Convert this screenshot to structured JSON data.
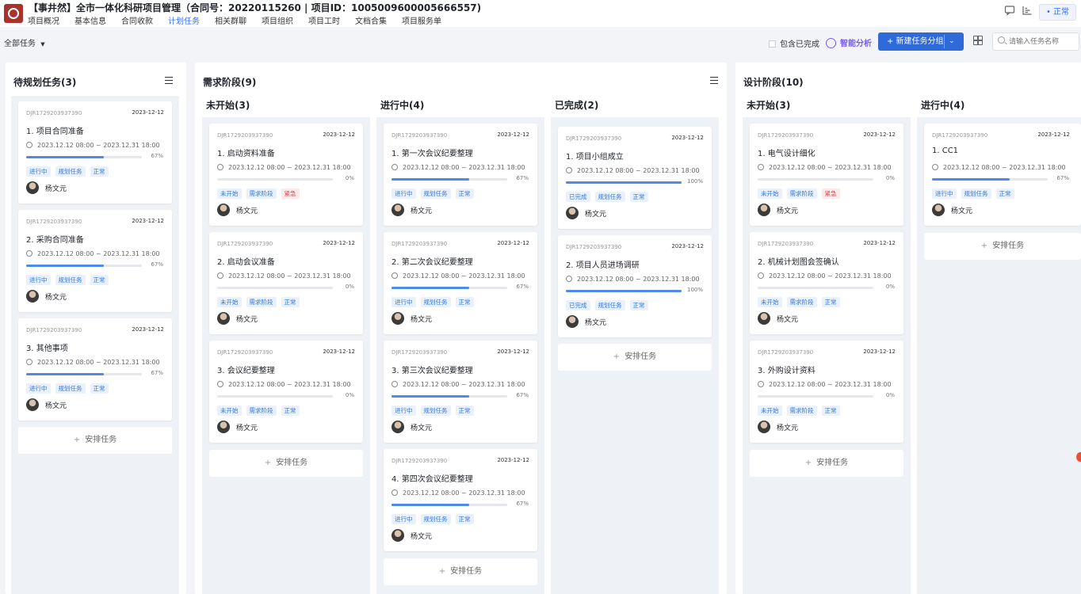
{
  "header": {
    "title": "【事井然】全市一体化科研项目管理（合同号：20220115260 | 项目ID：1005009600005666557)",
    "tabs": [
      "项目概况",
      "基本信息",
      "合同收款",
      "计划任务",
      "相关群聊",
      "项目组织",
      "项目工时",
      "文档合集",
      "项目服务单"
    ],
    "active_tab": "计划任务",
    "status": "• 正常",
    "icons": [
      "chat-icon",
      "chart-icon"
    ]
  },
  "toolbar": {
    "filter_label": "全部任务",
    "include_done_label": "包含已完成",
    "ai_label": "智能分析",
    "new_group_label": "+ 新建任务分组",
    "search_placeholder": "请输入任务名称"
  },
  "common": {
    "add_task": "安排任务",
    "assignee": "杨文元",
    "task_id": "DJR1729203937390",
    "date": "2023-12-12",
    "time_range": "2023.12.12 08:00 ~ 2023.12.31 18:00"
  },
  "boards": {
    "b0": {
      "title": "待规划任务(3)"
    },
    "b1": {
      "title": "需求阶段(9)"
    },
    "b2": {
      "title": "设计阶段(10)"
    }
  },
  "columns": {
    "c0": {
      "cards": [
        {
          "name": "1. 项目合同准备",
          "progress": 67,
          "pct": "67%",
          "tags": [
            "进行中",
            "规划任务",
            "正常"
          ]
        },
        {
          "name": "2. 采购合同准备",
          "progress": 67,
          "pct": "67%",
          "tags": [
            "进行中",
            "规划任务",
            "正常"
          ]
        },
        {
          "name": "3. 其他事项",
          "progress": 67,
          "pct": "67%",
          "tags": [
            "进行中",
            "规划任务",
            "正常"
          ]
        }
      ]
    },
    "c1": {
      "title": "未开始(3)",
      "cards": [
        {
          "name": "1. 启动资料准备",
          "progress": 0,
          "pct": "0%",
          "tags": [
            "未开始",
            "需求阶段",
            "紧急"
          ]
        },
        {
          "name": "2. 启动会议准备",
          "progress": 0,
          "pct": "0%",
          "tags": [
            "未开始",
            "需求阶段",
            "正常"
          ]
        },
        {
          "name": "3. 会议纪要整理",
          "progress": 0,
          "pct": "0%",
          "tags": [
            "未开始",
            "需求阶段",
            "正常"
          ]
        }
      ]
    },
    "c2": {
      "title": "进行中(4)",
      "cards": [
        {
          "name": "1. 第一次会议纪要整理",
          "progress": 67,
          "pct": "67%",
          "tags": [
            "进行中",
            "规划任务",
            "正常"
          ]
        },
        {
          "name": "2. 第二次会议纪要整理",
          "progress": 67,
          "pct": "67%",
          "tags": [
            "进行中",
            "规划任务",
            "正常"
          ]
        },
        {
          "name": "3. 第三次会议纪要整理",
          "progress": 67,
          "pct": "67%",
          "tags": [
            "进行中",
            "规划任务",
            "正常"
          ]
        },
        {
          "name": "4. 第四次会议纪要整理",
          "progress": 67,
          "pct": "67%",
          "tags": [
            "进行中",
            "规划任务",
            "正常"
          ]
        }
      ]
    },
    "c3": {
      "title": "已完成(2)",
      "cards": [
        {
          "name": "1. 项目小组成立",
          "progress": 100,
          "pct": "100%",
          "tags": [
            "已完成",
            "规划任务",
            "正常"
          ]
        },
        {
          "name": "2. 项目人员进场调研",
          "progress": 100,
          "pct": "100%",
          "tags": [
            "已完成",
            "规划任务",
            "正常"
          ]
        }
      ]
    },
    "c4": {
      "title": "未开始(3)",
      "cards": [
        {
          "name": "1. 电气设计细化",
          "progress": 0,
          "pct": "0%",
          "tags": [
            "未开始",
            "需求阶段",
            "紧急"
          ]
        },
        {
          "name": "2. 机械计划图会签确认",
          "progress": 0,
          "pct": "0%",
          "tags": [
            "未开始",
            "需求阶段",
            "正常"
          ]
        },
        {
          "name": "3. 外购设计资料",
          "progress": 0,
          "pct": "0%",
          "tags": [
            "未开始",
            "需求阶段",
            "正常"
          ]
        }
      ]
    },
    "c5": {
      "title": "进行中(4)",
      "cards": [
        {
          "name": "1. CC1",
          "progress": 67,
          "pct": "67%",
          "tags": [
            "进行中",
            "规划任务",
            "正常"
          ]
        }
      ]
    }
  }
}
